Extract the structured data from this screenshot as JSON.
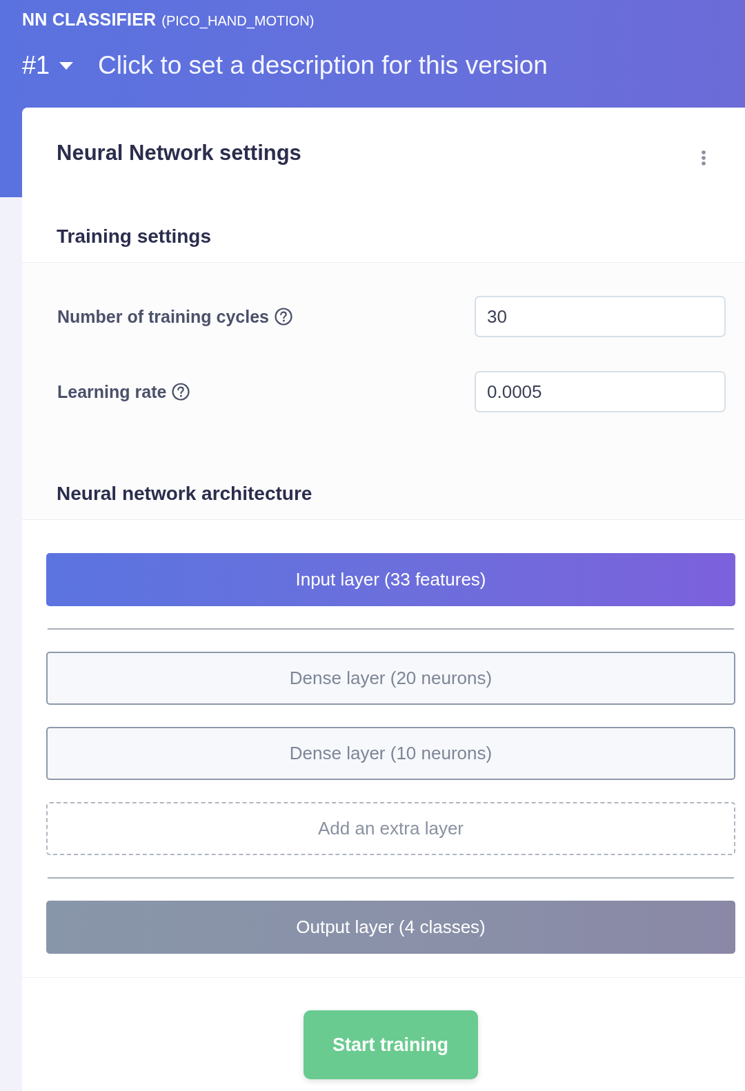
{
  "header": {
    "title": "NN CLASSIFIER",
    "project": "(PICO_HAND_MOTION)",
    "version": "#1",
    "description_prompt": "Click to set a description for this version"
  },
  "panel": {
    "title": "Neural Network settings"
  },
  "training_settings": {
    "heading": "Training settings",
    "fields": [
      {
        "label": "Number of training cycles",
        "value": "30"
      },
      {
        "label": "Learning rate",
        "value": "0.0005"
      }
    ]
  },
  "architecture": {
    "heading": "Neural network architecture",
    "layers": [
      {
        "kind": "input",
        "label": "Input layer (33 features)"
      },
      {
        "kind": "dense",
        "label": "Dense layer (20 neurons)"
      },
      {
        "kind": "dense",
        "label": "Dense layer (10 neurons)"
      },
      {
        "kind": "add",
        "label": "Add an extra layer"
      },
      {
        "kind": "output",
        "label": "Output layer (4 classes)"
      }
    ]
  },
  "actions": {
    "start_button": "Start training"
  }
}
